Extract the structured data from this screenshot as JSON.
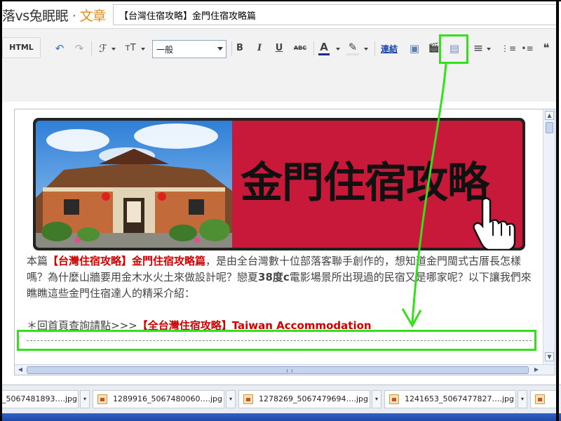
{
  "header": {
    "blog_name": "落vs兔眠眠",
    "separator": "·",
    "section": "文章",
    "post_title": "【台灣住宿攻略】金門住宿攻略篇"
  },
  "toolbar": {
    "html_label": "HTML",
    "font_style": "一般",
    "link_label": "連結",
    "icons": [
      "undo-icon",
      "redo-icon",
      "font-family-icon",
      "font-size-icon",
      "bold-icon",
      "italic-icon",
      "underline-icon",
      "strikethrough-icon",
      "text-color-icon",
      "highlight-icon",
      "link",
      "image-icon",
      "video-icon",
      "jump-break-icon",
      "align-icon",
      "numbered-list-icon",
      "bulleted-list-icon",
      "quote-icon"
    ],
    "glyphs": {
      "undo": "↶",
      "redo": "↷",
      "font": "ℱ",
      "size": "тT",
      "bold": "B",
      "italic": "I",
      "underline": "U",
      "strike": "ABC",
      "color": "A",
      "highlight": "✎",
      "image": "▣",
      "video": "🎬",
      "jump_break": "▤",
      "align": "≡",
      "ol": "⋮≡",
      "ul": "•≡",
      "quote": "❝"
    }
  },
  "banner": {
    "text": "金門住宿攻略",
    "colors": {
      "red": "#c8193a",
      "frame": "#222222"
    }
  },
  "content": {
    "p1_prefix": "本篇",
    "p1_red": "【台灣住宿攻略】金門住宿攻略篇",
    "p1_mid": "，是由全台灣數十位部落客聯手創作的，想知道金門閩式古厝長怎樣嗎？為什麼山牆要用金木水火土來做設計呢？戀夏",
    "p1_bold": "38度c",
    "p1_suffix": "電影場景所出現過的民宿又是哪家呢？以下讓我們來瞧瞧這些金門住宿達人的精采介紹：",
    "link_prefix": "＊回首頁查詢請點>>>",
    "link_red": "【全台灣住宿攻略】Taiwan Accommodation"
  },
  "taskbar": {
    "items": [
      {
        "name": "_5067481893….jpg"
      },
      {
        "name": "1289916_5067480060….jpg"
      },
      {
        "name": "1278269_5067479694….jpg"
      },
      {
        "name": "1241653_5067477827….jpg"
      }
    ],
    "dropdown": "▾"
  },
  "annotation_color": "#33e01a"
}
